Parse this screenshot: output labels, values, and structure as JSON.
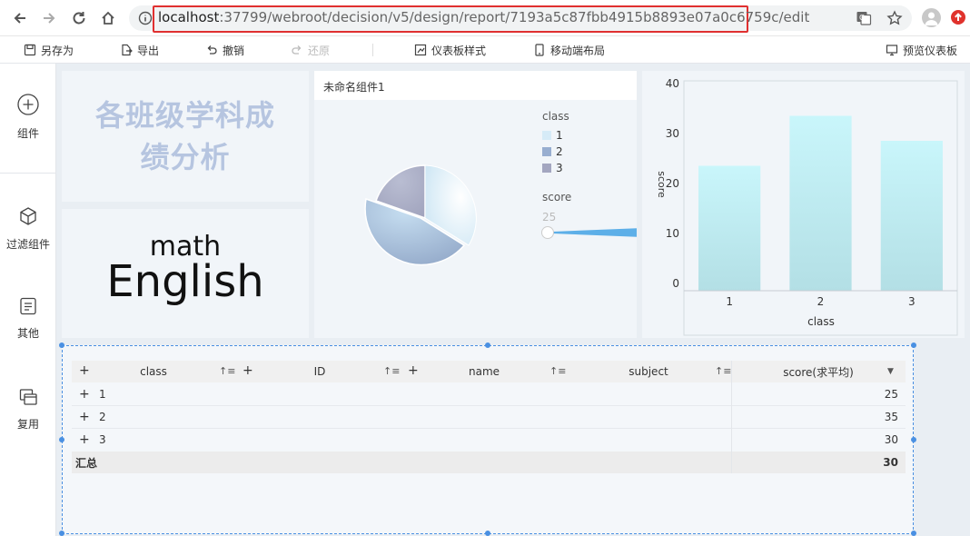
{
  "browser": {
    "url_host": "localhost",
    "url_path": ":37799/webroot/decision/v5/design/report/7193a5c87fbb4915b8893e07a0c6759c/edit"
  },
  "toolbar": {
    "save_as": "另存为",
    "export": "导出",
    "undo": "撤销",
    "redo": "还原",
    "dashboard_style": "仪表板样式",
    "mobile_layout": "移动端布局",
    "preview": "预览仪表板"
  },
  "sidebar": {
    "items": [
      {
        "label": "组件",
        "icon": "plus-circle-icon"
      },
      {
        "label": "过滤组件",
        "icon": "cube-icon"
      },
      {
        "label": "其他",
        "icon": "document-icon"
      },
      {
        "label": "复用",
        "icon": "windows-icon"
      }
    ]
  },
  "title_widget": {
    "line1": "各班级学科成",
    "line2": "绩分析"
  },
  "subjects_widget": {
    "word1": "math",
    "word2": "English"
  },
  "pie_widget": {
    "title": "未命名组件1",
    "legend_title": "class",
    "legend": [
      {
        "label": "1",
        "color": "#d6ebf7"
      },
      {
        "label": "2",
        "color": "#98aed0"
      },
      {
        "label": "3",
        "color": "#a3a6c0"
      }
    ],
    "size_legend_title": "score",
    "size_legend_value": "25"
  },
  "chart_data": {
    "type": "bar",
    "categories": [
      "1",
      "2",
      "3"
    ],
    "values": [
      25,
      35,
      30
    ],
    "xlabel": "class",
    "ylabel": "score",
    "ylim": [
      0,
      40
    ],
    "yticks": [
      "0",
      "10",
      "20",
      "30",
      "40"
    ],
    "color_top": "#c9f6fb",
    "color_bottom": "#b3dfe5",
    "grid": false
  },
  "table": {
    "headers": {
      "class": "class",
      "id": "ID",
      "name": "name",
      "subject": "subject",
      "score": "score(求平均)"
    },
    "rows": [
      {
        "class": "1",
        "score": "25"
      },
      {
        "class": "2",
        "score": "35"
      },
      {
        "class": "3",
        "score": "30"
      }
    ],
    "total_label": "汇总",
    "total_score": "30"
  }
}
